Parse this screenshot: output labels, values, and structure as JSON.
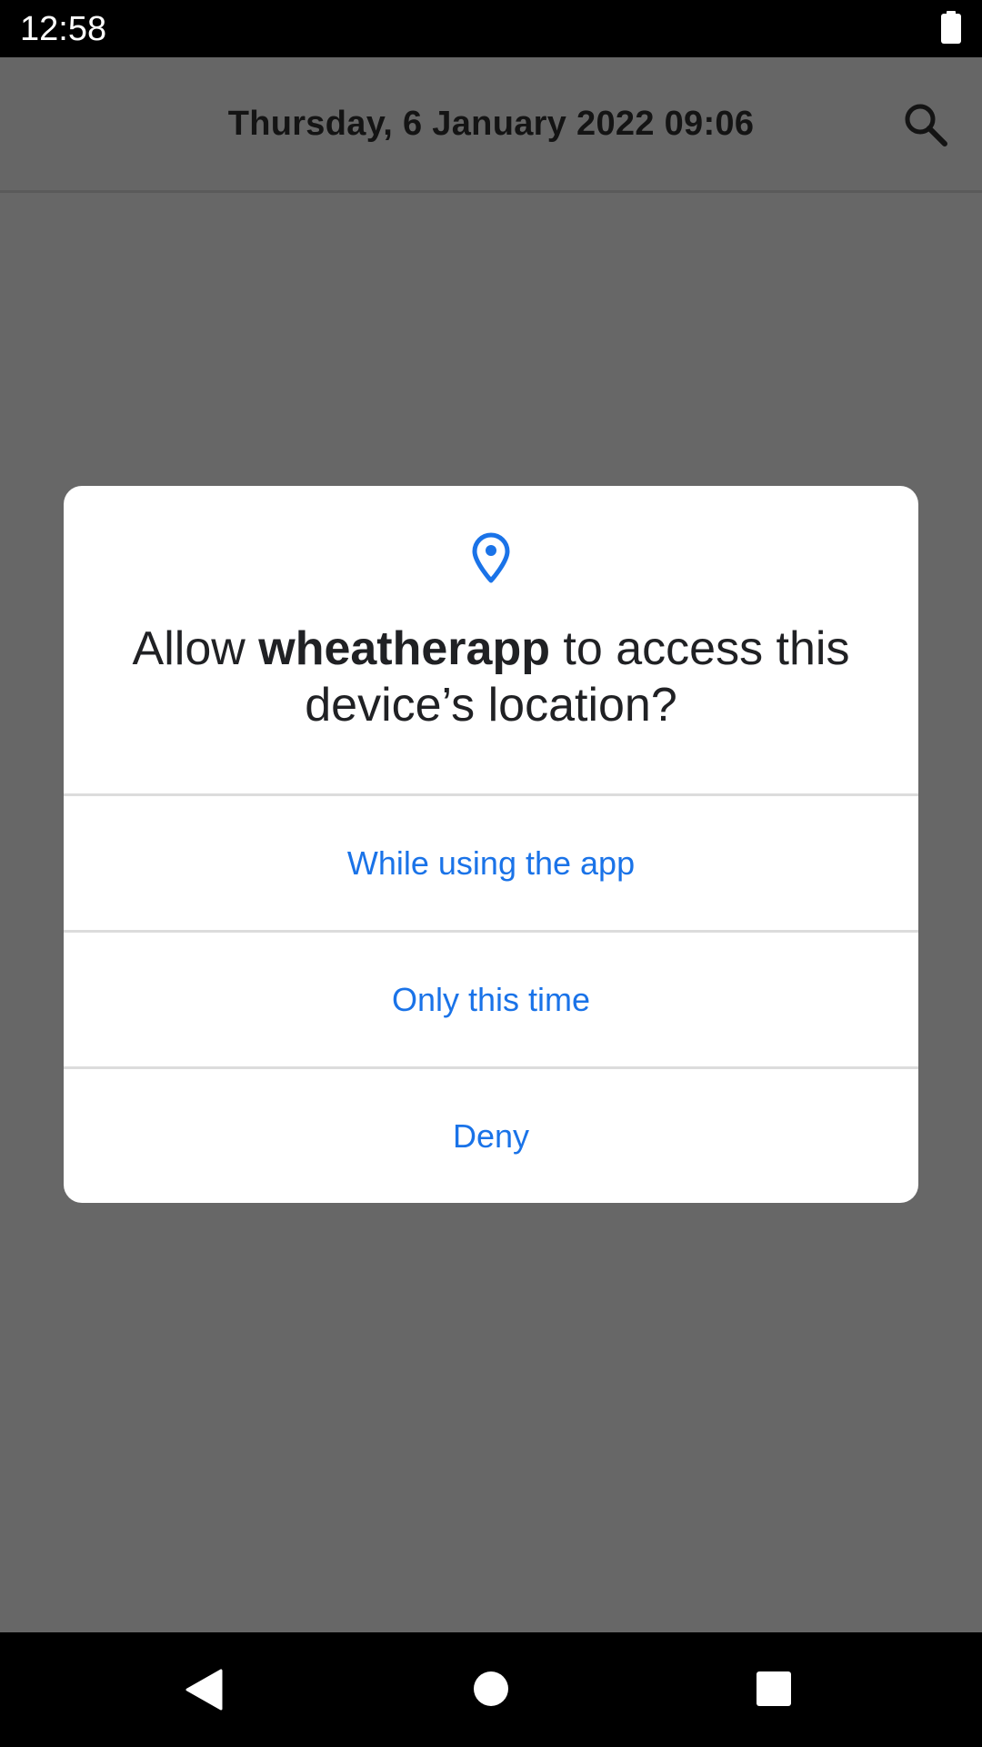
{
  "status_bar": {
    "time": "12:58",
    "battery_icon": "battery-full-icon"
  },
  "app_bar": {
    "title": "Thursday, 6 January 2022 09:06",
    "search_icon": "search-icon"
  },
  "dialog": {
    "icon": "location-pin-icon",
    "title_prefix": "Allow ",
    "title_app": "wheatherapp",
    "title_suffix": " to access this device’s location?",
    "options": [
      {
        "label": "While using the app"
      },
      {
        "label": "Only this time"
      },
      {
        "label": "Deny"
      }
    ]
  },
  "nav_bar": {
    "back_icon": "back-triangle-icon",
    "home_icon": "home-circle-icon",
    "recents_icon": "recents-square-icon"
  },
  "colors": {
    "accent": "#1a73e8",
    "scrim": "#676767",
    "dialog_bg": "#ffffff",
    "text_primary": "#202124"
  }
}
